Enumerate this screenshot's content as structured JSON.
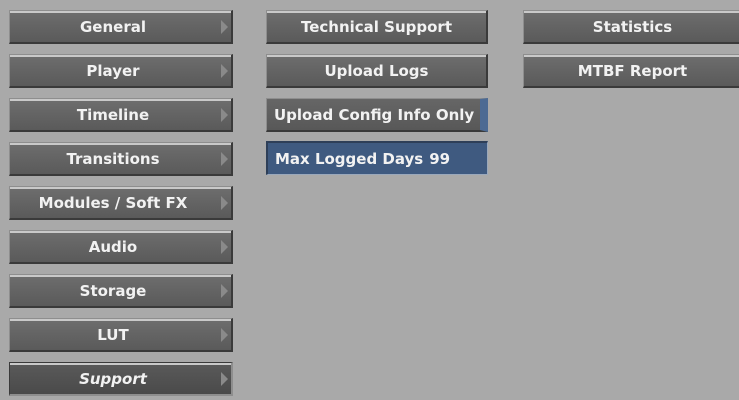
{
  "sidebar": {
    "items": [
      {
        "label": "General"
      },
      {
        "label": "Player"
      },
      {
        "label": "Timeline"
      },
      {
        "label": "Transitions"
      },
      {
        "label": "Modules / Soft FX"
      },
      {
        "label": "Audio"
      },
      {
        "label": "Storage"
      },
      {
        "label": "LUT"
      },
      {
        "label": "Support",
        "selected": true
      }
    ]
  },
  "support_panel": {
    "technical_support_label": "Technical Support",
    "upload_logs_label": "Upload Logs",
    "upload_config_label": "Upload Config Info Only",
    "max_logged_days_label": "Max Logged Days",
    "max_logged_days_value": "99"
  },
  "stats_panel": {
    "statistics_label": "Statistics",
    "mtbf_report_label": "MTBF Report"
  },
  "colors": {
    "background": "#a9a9a9",
    "button": "#636363",
    "input_fill": "#3f5a80",
    "toggle_accent": "#4c6a93",
    "text": "#f2f2f2"
  }
}
